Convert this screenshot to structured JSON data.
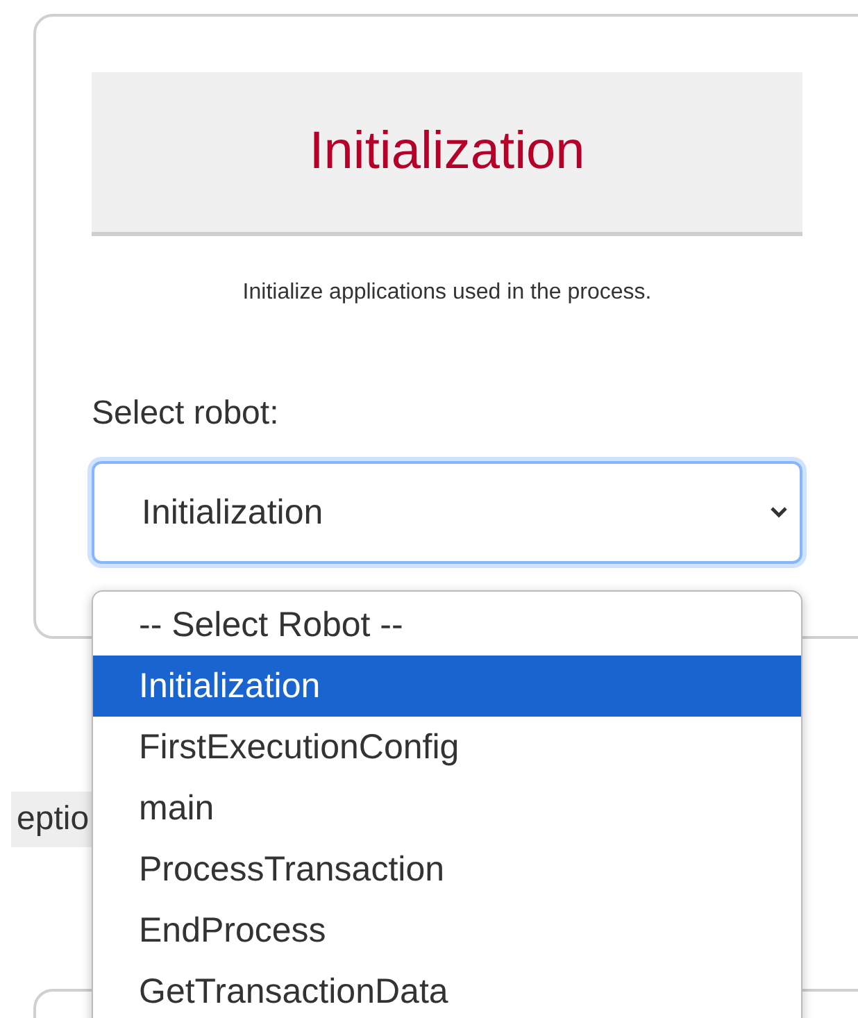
{
  "card": {
    "title": "Initialization",
    "description": "Initialize applications used in the process.",
    "select_label": "Select robot:",
    "select": {
      "value": "Initialization",
      "expanded": true,
      "options": [
        {
          "label": "-- Select Robot --",
          "selected": false
        },
        {
          "label": "Initialization",
          "selected": true
        },
        {
          "label": "FirstExecutionConfig",
          "selected": false
        },
        {
          "label": "main",
          "selected": false
        },
        {
          "label": "ProcessTransaction",
          "selected": false
        },
        {
          "label": "EndProcess",
          "selected": false
        },
        {
          "label": "GetTransactionData",
          "selected": false
        }
      ]
    }
  },
  "background_chip": {
    "text": "eptio"
  }
}
